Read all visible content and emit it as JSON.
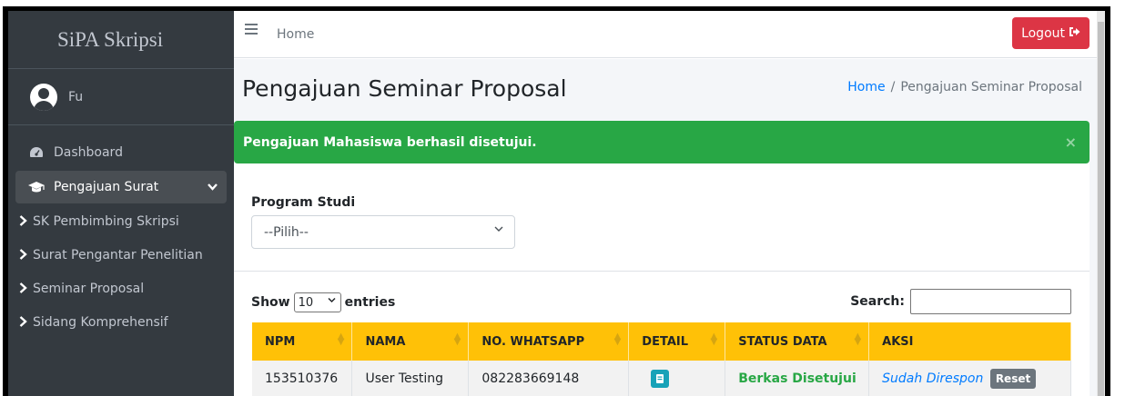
{
  "sidebar": {
    "brand": "SiPA Skripsi",
    "user_name": "Fu",
    "items": [
      {
        "label": "Dashboard",
        "icon": "tachometer-icon"
      },
      {
        "label": "Pengajuan Surat",
        "icon": "graduation-cap-icon",
        "active": true
      }
    ],
    "sub_items": [
      {
        "label": "SK Pembimbing Skripsi"
      },
      {
        "label": "Surat Pengantar Penelitian"
      },
      {
        "label": "Seminar Proposal"
      },
      {
        "label": "Sidang Komprehensif"
      }
    ]
  },
  "topbar": {
    "home_link": "Home",
    "logout_label": "Logout"
  },
  "page": {
    "title": "Pengajuan Seminar Proposal",
    "breadcrumb": [
      "Home",
      "Pengajuan Seminar Proposal"
    ]
  },
  "alert": {
    "message": "Pengajuan Mahasiswa berhasil disetujui.",
    "close": "×",
    "color": "#28a745"
  },
  "filter": {
    "label": "Program Studi",
    "selected": "--Pilih--"
  },
  "table_controls": {
    "show_label": "Show",
    "entries_value": "10",
    "entries_label": "entries",
    "search_label": "Search:"
  },
  "table": {
    "headers": [
      "NPM",
      "NAMA",
      "NO. WHATSAPP",
      "DETAIL",
      "STATUS DATA",
      "AKSI"
    ],
    "rows": [
      {
        "npm": "153510376",
        "nama": "User Testing",
        "whatsapp": "082283669148",
        "detail_icon": "file-icon",
        "status": "Berkas Disetujui",
        "aksi_text": "Sudah Direspon",
        "aksi_button": "Reset"
      }
    ]
  },
  "colors": {
    "sidebar": "#343a40",
    "header_bg": "#ffc107",
    "logout": "#dc3545",
    "link": "#007bff"
  }
}
